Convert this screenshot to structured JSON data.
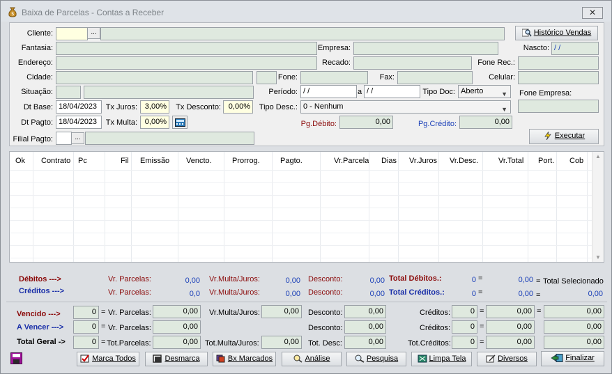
{
  "window": {
    "title": "Baixa de Parcelas - Contas a Receber",
    "close": "✕"
  },
  "labels": {
    "cliente": "Cliente:",
    "fantasia": "Fantasia:",
    "endereco": "Endereço:",
    "cidade": "Cidade:",
    "situacao": "Situação:",
    "dt_base": "Dt Base:",
    "dt_pagto": "Dt Pagto:",
    "filial_pagto": "Filial Pagto:",
    "empresa": "Empresa:",
    "recado": "Recado:",
    "fone": "Fone:",
    "fax": "Fax:",
    "nascto": "Nascto:",
    "fone_rec": "Fone Rec.:",
    "celular": "Celular:",
    "fone_empresa": "Fone Empresa:",
    "periodo": "Período:",
    "periodo_a": "a",
    "tipo_doc": "Tipo Doc:",
    "tipo_desc": "Tipo Desc.:",
    "tx_juros": "Tx Juros:",
    "tx_desconto": "Tx Desconto:",
    "tx_multa": "Tx Multa:",
    "pg_debito": "Pg.Débito:",
    "pg_credito": "Pg.Crédito:"
  },
  "values": {
    "cliente_btn": "...",
    "filial_btn": "...",
    "nascto": " /  /",
    "periodo_ini": " /  /",
    "periodo_fim": " /  /",
    "dt_base": "18/04/2023",
    "dt_pagto": "18/04/2023",
    "tx_juros": "3,00%",
    "tx_desconto": "0,00%",
    "tx_multa": "0,00%",
    "tipo_doc": "Aberto",
    "tipo_desc": "0 - Nenhum",
    "pg_debito": "0,00",
    "pg_credito": "0,00"
  },
  "buttons": {
    "historico": "Histórico Vendas",
    "executar": "Executar"
  },
  "grid": {
    "columns": [
      "Ok",
      "Contrato",
      "Pc",
      "Fil",
      "Emissão",
      "Vencto.",
      "Prorrog.",
      "Pagto.",
      "Vr.Parcela",
      "Dias",
      "Vr.Juros",
      "Vr.Desc.",
      "Vr.Total",
      "Port.",
      "Cob"
    ]
  },
  "summary": {
    "debitos": "Débitos --->",
    "creditos": "Créditos --->",
    "vr_parcelas": "Vr. Parcelas:",
    "vr_multa_juros": "Vr.Multa/Juros:",
    "desconto": "Desconto:",
    "deb_parcelas": "0,00",
    "deb_multa": "0,00",
    "deb_desconto": "0,00",
    "cred_parcelas": "0,0",
    "cred_multa": "0,00",
    "cred_desconto": "0,00",
    "total_debitos": "Total Débitos.:",
    "total_creditos": "Total Créditos.:",
    "td_count": "0",
    "td_value": "0,00",
    "tc_count": "0",
    "tc_value": "0,00",
    "eq": "=",
    "total_selecionado": "Total Selecionado",
    "total_sel_value": "0,00"
  },
  "totals": {
    "vencido": "Vencido --->",
    "a_vencer": "A Vencer --->",
    "total_geral": "Total Geral ->",
    "vr_parcelas": "Vr. Parcelas:",
    "tot_parcelas": "Tot.Parcelas:",
    "vr_multa_juros": "Vr.Multa/Juros:",
    "tot_multa_juros": "Tot.Multa/Juros:",
    "desconto": "Desconto:",
    "tot_desc": "Tot. Desc:",
    "creditos": "Créditos:",
    "tot_creditos": "Tot.Créditos:",
    "eq": "=",
    "zero": "0",
    "zero_val": "0,00"
  },
  "footer": {
    "marca_todos": "Marca Todos",
    "desmarca": "Desmarca",
    "bx_marcados": "Bx Marcados",
    "analise": "Análise",
    "pesquisa": "Pesquisa",
    "limpa_tela": "Limpa Tela",
    "diversos": "Diversos",
    "finalizar": "Finalizar"
  },
  "colors": {
    "field_green": "#dfe9df",
    "field_yellow": "#ffffe1",
    "accent_red": "#8b0a0a",
    "accent_blue": "#1a3fb8"
  },
  "icons": [
    "money-bag-icon",
    "magnifier-icon",
    "lightning-icon",
    "calculator-icon",
    "save-disk-icon",
    "check-icon",
    "clear-icon",
    "stack-icon",
    "analysis-icon",
    "search-icon",
    "broom-icon",
    "edit-icon",
    "exit-icon"
  ]
}
